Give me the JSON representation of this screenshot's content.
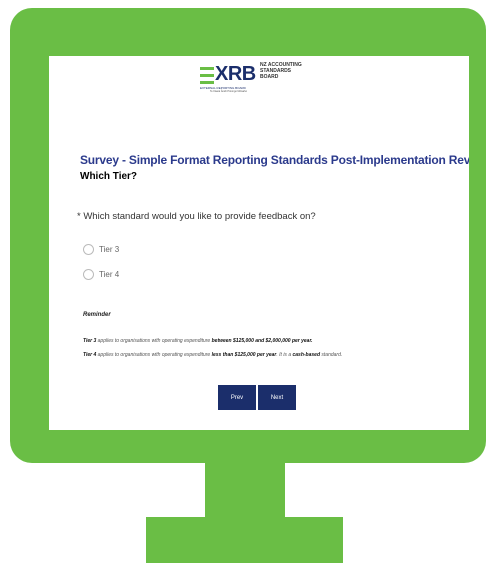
{
  "logo": {
    "brand": "XRB",
    "brand_sub": "EXTERNAL REPORTING BOARD",
    "brand_sub2": "Te Kāwai Ārahi Pūrongo Mōwaho",
    "board_name_lines": [
      "NZ ACCOUNTING",
      "STANDARDS",
      "BOARD"
    ]
  },
  "survey": {
    "title": "Survey - Simple Format Reporting Standards Post-Implementation Review",
    "subtitle": "Which Tier?",
    "question": "* Which standard would you like to provide feedback on?",
    "options": [
      "Tier 3",
      "Tier 4"
    ]
  },
  "reminder": {
    "heading": "Reminder",
    "tier3": {
      "label": "Tier 3",
      "text": " applies to organisations with operating expenditure ",
      "bold": "between $125,000 and $2,000,000 per year."
    },
    "tier4": {
      "label": "Tier 4",
      "text": " applies to organisations with operating expenditure ",
      "bold": "less than $125,000 per year",
      "text2": ". It is a ",
      "bold2": "cash-based",
      "text3": " standard."
    }
  },
  "buttons": {
    "prev": "Prev",
    "next": "Next"
  },
  "colors": {
    "monitor": "#6abe45",
    "brand_navy": "#1b2e6b",
    "title_blue": "#2b3a8c"
  }
}
